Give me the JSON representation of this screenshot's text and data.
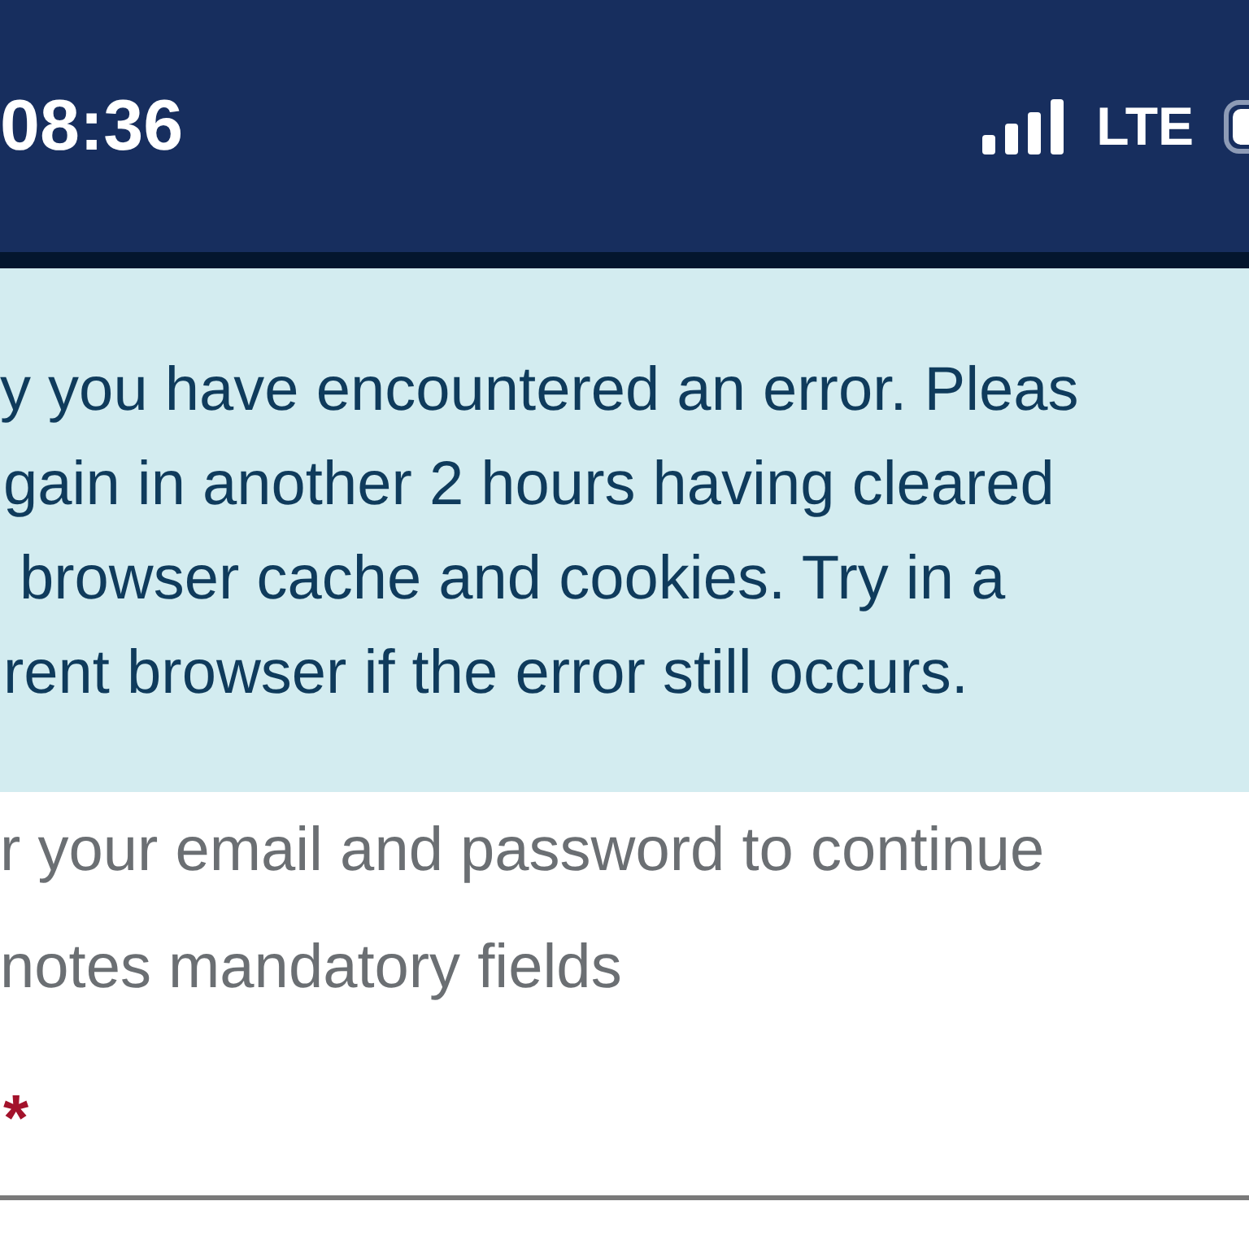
{
  "status_bar": {
    "time": "08:36",
    "network": "LTE"
  },
  "error_alert": {
    "lines": [
      "y you have encountered an error. Pleas",
      "gain in another 2 hours having cleared",
      "browser cache and cookies. Try in a",
      "rent browser if the error still occurs."
    ]
  },
  "form": {
    "instructions": [
      "r your email and password to continue",
      "notes mandatory fields"
    ],
    "required_mark": "*"
  }
}
